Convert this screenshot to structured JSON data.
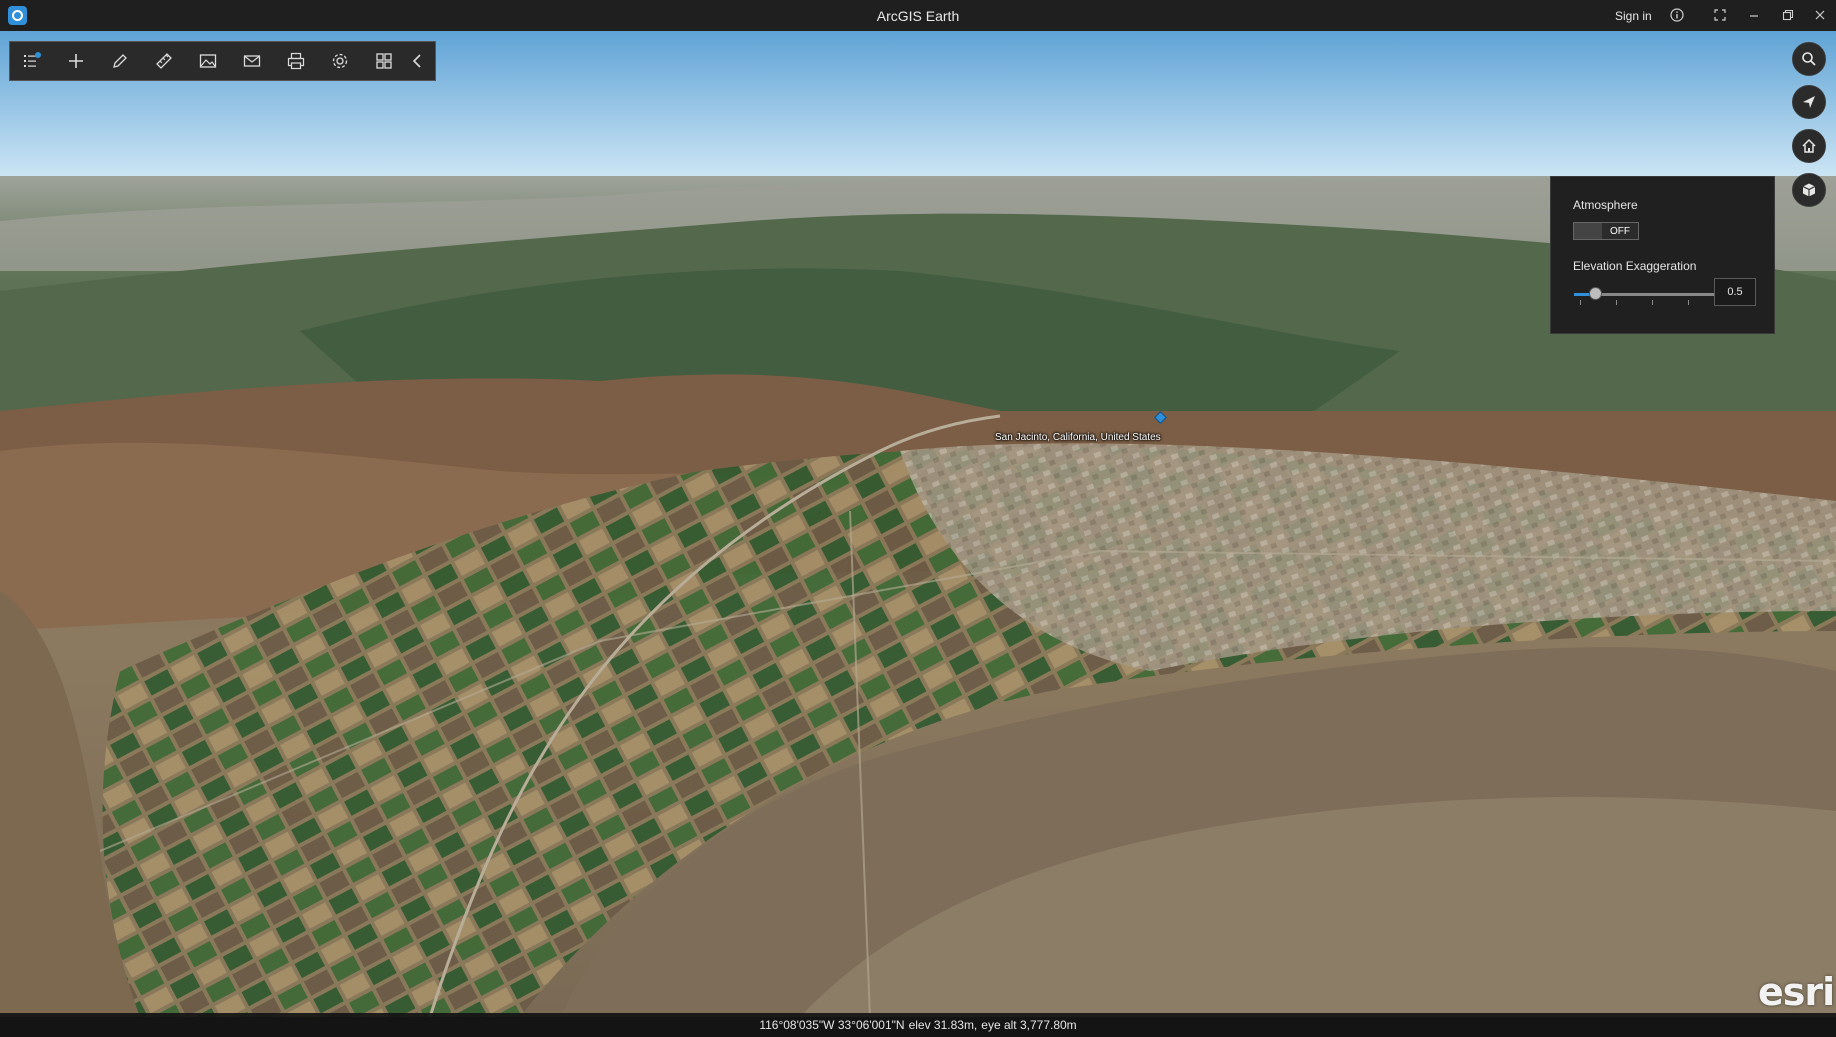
{
  "window": {
    "title": "ArcGIS Earth",
    "sign_in": "Sign in"
  },
  "toolbar": {
    "items": [
      {
        "name": "layers",
        "icon": "layers-list-icon"
      },
      {
        "name": "add",
        "icon": "plus-icon"
      },
      {
        "name": "draw",
        "icon": "pencil-icon"
      },
      {
        "name": "measure",
        "icon": "ruler-icon"
      },
      {
        "name": "image",
        "icon": "image-icon"
      },
      {
        "name": "email",
        "icon": "mail-icon"
      },
      {
        "name": "print",
        "icon": "printer-icon"
      },
      {
        "name": "settings",
        "icon": "gear-icon"
      },
      {
        "name": "apps",
        "icon": "grid-icon"
      },
      {
        "name": "collapse",
        "icon": "chevron-left-icon"
      }
    ]
  },
  "nav": {
    "buttons": [
      {
        "name": "search",
        "icon": "search-icon"
      },
      {
        "name": "navigate",
        "icon": "navigation-arrow-icon"
      },
      {
        "name": "home",
        "icon": "home-icon"
      },
      {
        "name": "scene-settings",
        "icon": "cube-icon"
      }
    ]
  },
  "panel": {
    "atmosphere_label": "Atmosphere",
    "atmosphere_state": "OFF",
    "elevation_label": "Elevation Exaggeration",
    "elevation_value": "0.5",
    "elevation_fraction": 0.12
  },
  "map": {
    "place_label": "San Jacinto, California, United States"
  },
  "status": {
    "coordinates": "116°08'035\"W 33°06'001\"N",
    "elev": "elev 31.83m,",
    "eye_alt": "eye alt 3,777.80m"
  },
  "brand": {
    "logo": "esri"
  },
  "colors": {
    "accent": "#2f8fd8",
    "sky_top": "#5fa3d6",
    "sky_horizon": "#cfe7f5",
    "panel_bg": "#202020"
  }
}
